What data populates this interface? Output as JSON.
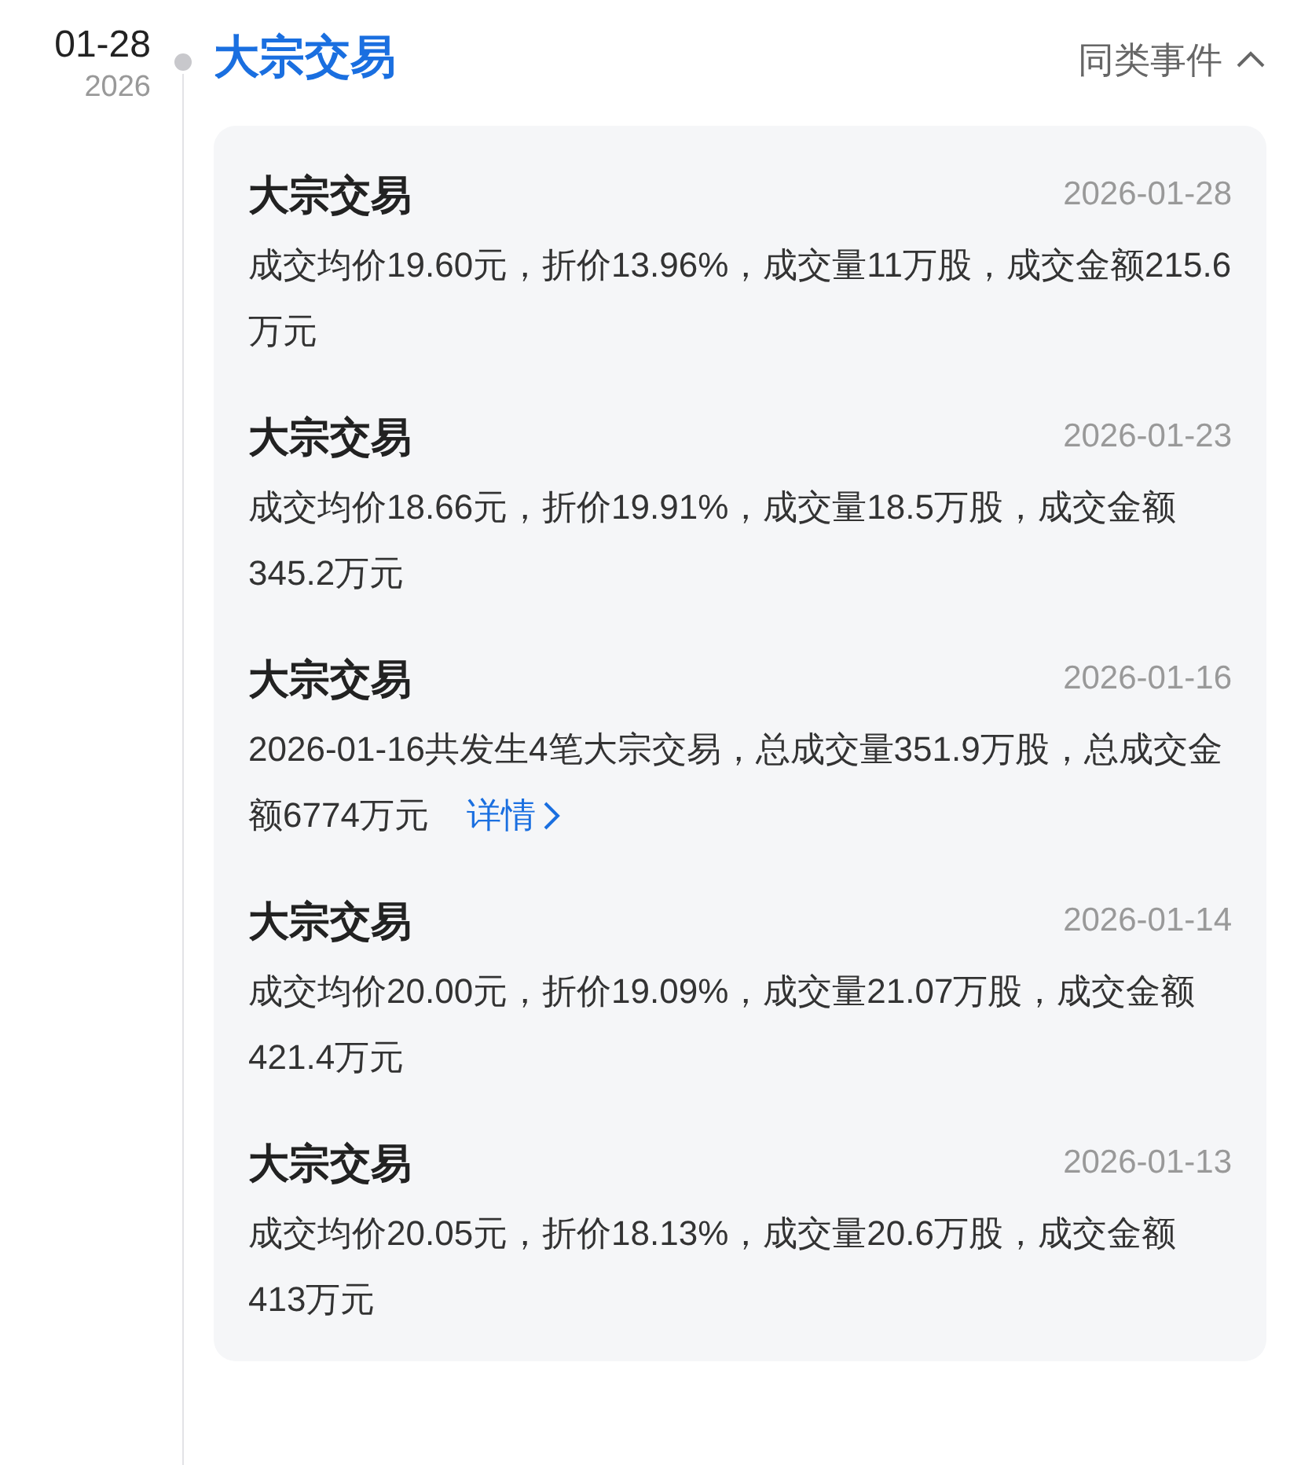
{
  "date": {
    "day": "01-28",
    "year": "2026"
  },
  "group": {
    "title": "大宗交易",
    "related": "同类事件",
    "expanded": true
  },
  "events": [
    {
      "title": "大宗交易",
      "date": "2026-01-28",
      "body": "成交均价19.60元，折价13.96%，成交量11万股，成交金额215.6万元"
    },
    {
      "title": "大宗交易",
      "date": "2026-01-23",
      "body": "成交均价18.66元，折价19.91%，成交量18.5万股，成交金额345.2万元"
    },
    {
      "title": "大宗交易",
      "date": "2026-01-16",
      "body": "2026-01-16共发生4笔大宗交易，总成交量351.9万股，总成交金额6774万元",
      "link": "详情"
    },
    {
      "title": "大宗交易",
      "date": "2026-01-14",
      "body": "成交均价20.00元，折价19.09%，成交量21.07万股，成交金额421.4万元"
    },
    {
      "title": "大宗交易",
      "date": "2026-01-13",
      "body": "成交均价20.05元，折价18.13%，成交量20.6万股，成交金额413万元"
    }
  ]
}
